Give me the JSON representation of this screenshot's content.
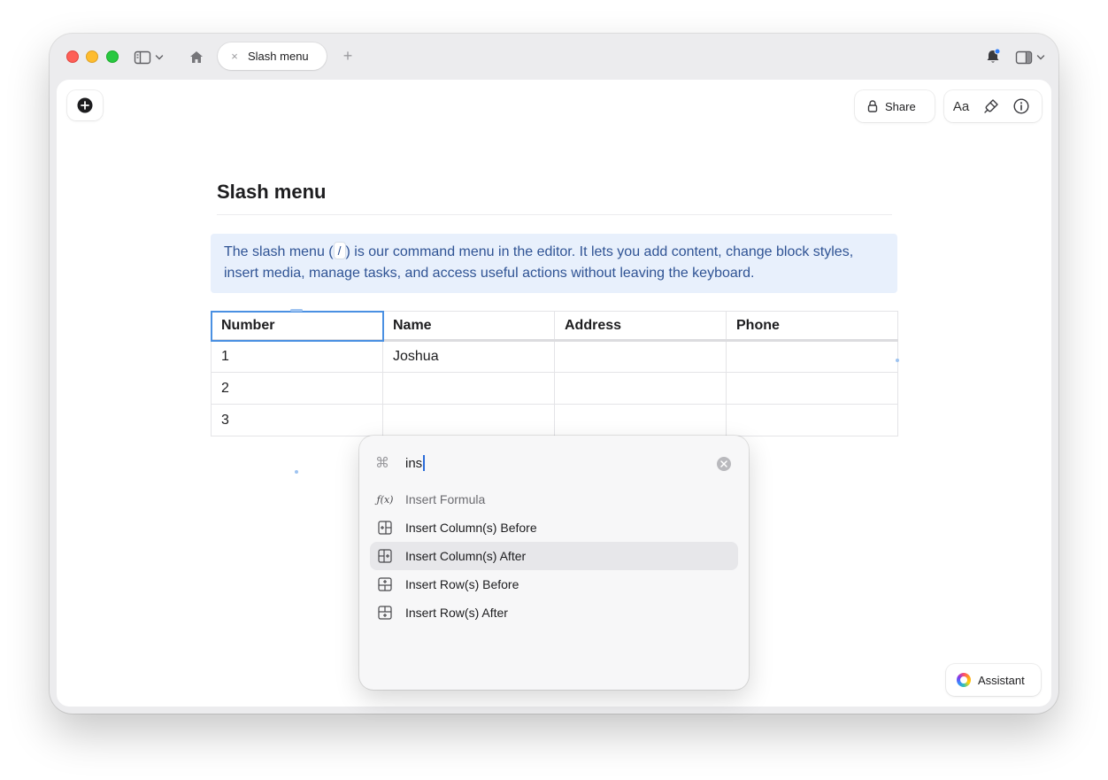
{
  "window": {
    "tab": {
      "title": "Slash menu",
      "close_glyph": "×"
    },
    "new_tab_glyph": "+",
    "icons": {
      "sidebar": "sidebar-toggle-icon",
      "home": "home-icon",
      "bell": "bell-icon",
      "panel": "right-panel-icon"
    },
    "colors": {
      "traffic_red": "#fe5f57",
      "traffic_yellow": "#febc2e",
      "traffic_green": "#28c840",
      "notification_dot": "#2f7cf6"
    }
  },
  "toolbar": {
    "share_label": "Share",
    "font_label": "Aa"
  },
  "document": {
    "title": "Slash menu",
    "callout": {
      "before": "The slash menu (",
      "key": "/",
      "after": ") is our command menu in the editor. It lets you add content, change block styles, insert media, manage tasks, and access useful actions without leaving the keyboard."
    },
    "table": {
      "headers": [
        "Number",
        "Name",
        "Address",
        "Phone"
      ],
      "rows": [
        [
          "1",
          "Joshua",
          "",
          ""
        ],
        [
          "2",
          "",
          "",
          ""
        ],
        [
          "3",
          "",
          "",
          ""
        ]
      ]
    }
  },
  "command_menu": {
    "query": "ins",
    "command_symbol": "⌘",
    "items": [
      {
        "label": "Insert Formula",
        "icon": "formula-icon",
        "icon_text": "ƒ(x)"
      },
      {
        "label": "Insert Column(s) Before",
        "icon": "insert-column-before-icon"
      },
      {
        "label": "Insert Column(s) After",
        "icon": "insert-column-after-icon",
        "highlighted": true
      },
      {
        "label": "Insert Row(s) Before",
        "icon": "insert-row-before-icon"
      },
      {
        "label": "Insert Row(s) After",
        "icon": "insert-row-after-icon"
      }
    ]
  },
  "assistant": {
    "label": "Assistant"
  }
}
